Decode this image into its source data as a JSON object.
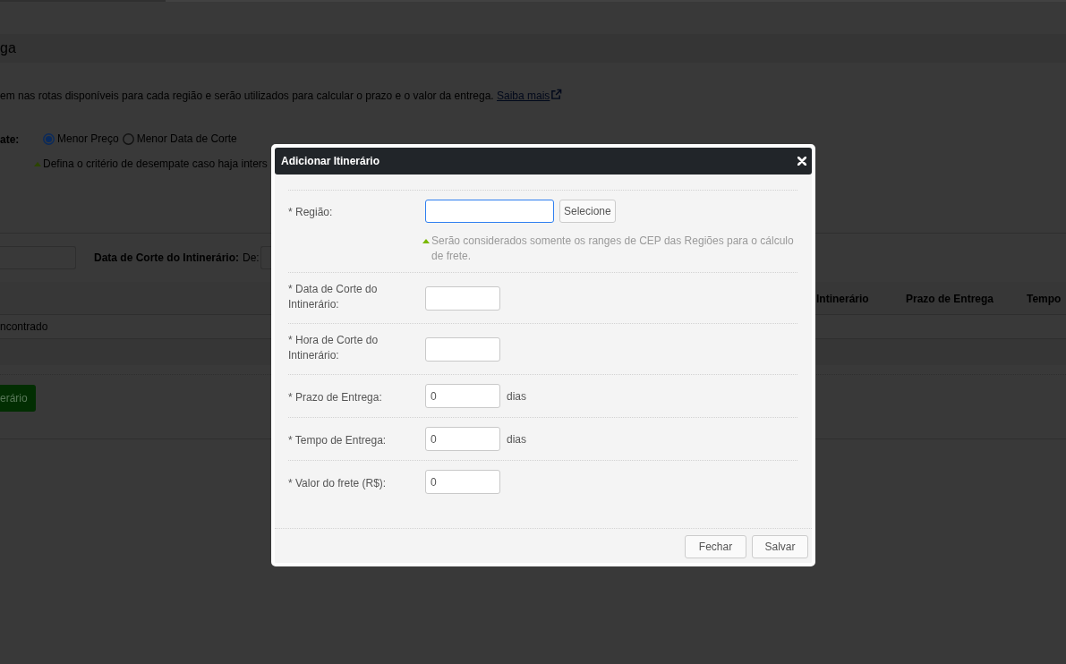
{
  "page": {
    "title": "ga",
    "description": "em nas rotas disponíveis para cada região e serão utilizados para calcular o prazo e o valor da entrega.",
    "link": "Saiba mais"
  },
  "tiebreak": {
    "label": "ate:",
    "options": [
      {
        "label": "Menor Preço",
        "selected": true
      },
      {
        "label": "Menor Data de Corte",
        "selected": false
      }
    ],
    "hint": "Defina o critério de desempate caso haja inters"
  },
  "filters": {
    "cutoff_date_label": "Data de Corte do Intinerário:",
    "from_label": "De:"
  },
  "table": {
    "columns": [
      "Intinerário",
      "Prazo de Entrega",
      "Tempo"
    ],
    "rows": [
      {
        "text": "ncontrado"
      }
    ]
  },
  "add_button": "erário",
  "modal": {
    "title": "Adicionar Itinerário",
    "fields": [
      {
        "kind": "lookup",
        "label": "* Região:",
        "focused": true,
        "button": "Selecione",
        "hint": "Serão considerados somente os ranges de CEP das Regiões para o cálculo de frete."
      },
      {
        "kind": "input",
        "label": "* Data de Corte do Intinerário:",
        "focused": false
      },
      {
        "kind": "input",
        "label": "* Hora de Corte do Intinerário:",
        "focused": false
      },
      {
        "kind": "input",
        "label": "* Prazo de Entrega:",
        "value": "0",
        "unit": "dias",
        "focused": false
      },
      {
        "kind": "input",
        "label": "* Tempo de Entrega:",
        "value": "0",
        "unit": "dias",
        "focused": false
      },
      {
        "kind": "input",
        "label": "* Valor do frete (R$):",
        "value": "0",
        "focused": false
      }
    ],
    "buttons": [
      {
        "label": "Fechar"
      },
      {
        "label": "Salvar"
      }
    ]
  }
}
